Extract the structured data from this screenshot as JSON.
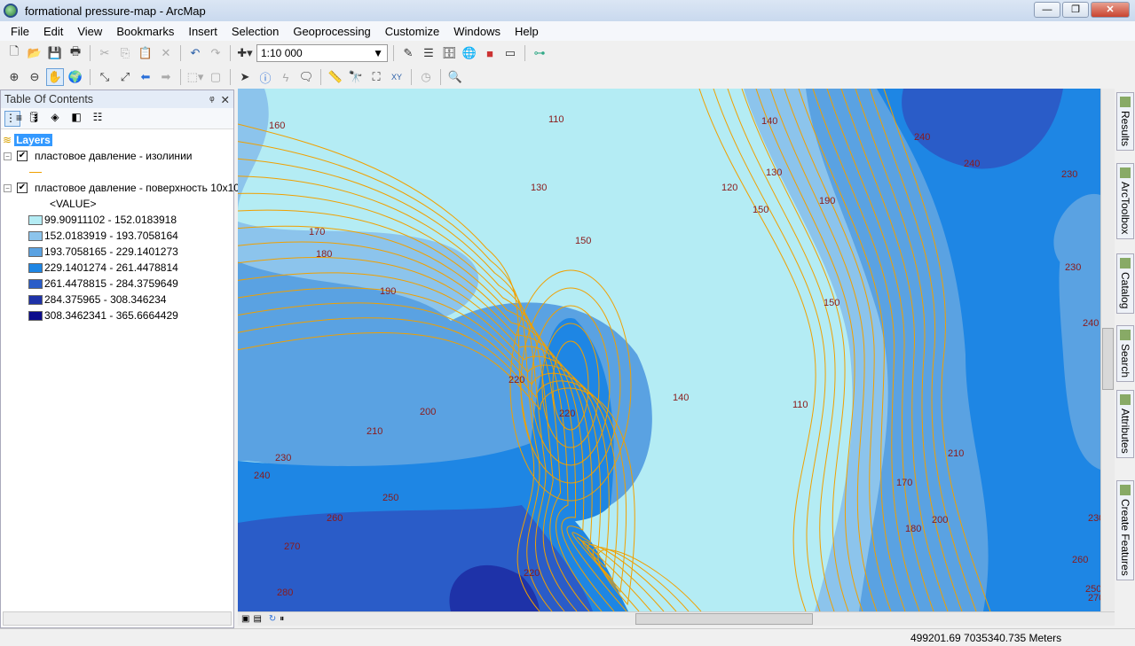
{
  "window": {
    "title": "formational pressure-map - ArcMap",
    "minimize": "—",
    "maximize": "❐",
    "close": "✕"
  },
  "menu": [
    "File",
    "Edit",
    "View",
    "Bookmarks",
    "Insert",
    "Selection",
    "Geoprocessing",
    "Customize",
    "Windows",
    "Help"
  ],
  "toolbar": {
    "scale": "1:10 000"
  },
  "toc": {
    "title": "Table Of Contents",
    "pin": "ᵠ",
    "close": "✕",
    "root": "Layers",
    "layers": [
      {
        "name": "пластовое давление - изолинии",
        "checked": true,
        "line_color": "#f0a000"
      },
      {
        "name": "пластовое давление - поверхность 10x10",
        "checked": true,
        "field": "<VALUE>",
        "classes": [
          {
            "label": "99.90911102 - 152.0183918",
            "color": "#b4ecf4"
          },
          {
            "label": "152.0183919 - 193.7058164",
            "color": "#8cc4ec"
          },
          {
            "label": "193.7058165 - 229.1401273",
            "color": "#5aa2e2"
          },
          {
            "label": "229.1401274 - 261.4478814",
            "color": "#1e86e4"
          },
          {
            "label": "261.4478815 - 284.3759649",
            "color": "#2a5cc8"
          },
          {
            "label": "284.375965 - 308.346234",
            "color": "#1e32a8"
          },
          {
            "label": "308.3462341 - 365.6664429",
            "color": "#0c0c8c"
          }
        ]
      }
    ]
  },
  "contour_labels": [
    "160",
    "110",
    "130",
    "150",
    "140",
    "130",
    "120",
    "150",
    "190",
    "240",
    "240",
    "230",
    "170",
    "180",
    "150",
    "190",
    "230",
    "240",
    "220",
    "220",
    "140",
    "110",
    "200",
    "210",
    "230",
    "240",
    "250",
    "260",
    "270",
    "280",
    "220",
    "210",
    "170",
    "180",
    "200",
    "230",
    "250",
    "260",
    "270"
  ],
  "dock_tabs": [
    "Results",
    "ArcToolbox",
    "Catalog",
    "Search",
    "Attributes",
    "Create Features"
  ],
  "status": {
    "coords": "499201.69  7035340.735 Meters"
  }
}
